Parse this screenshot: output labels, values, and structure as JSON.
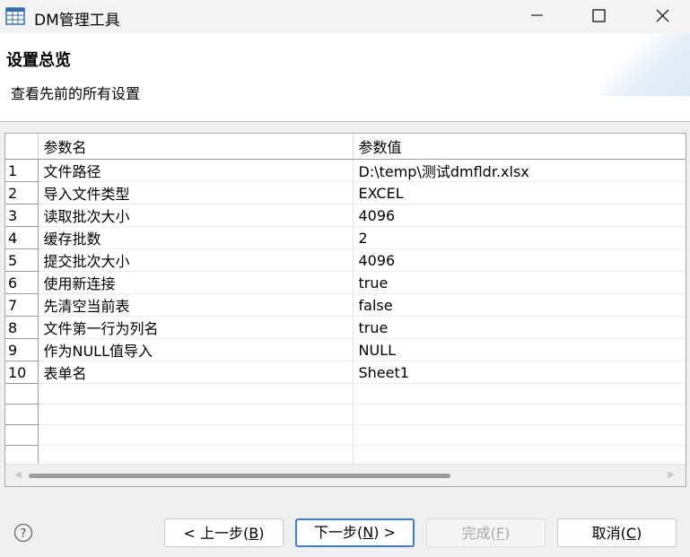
{
  "window": {
    "title": "DM管理工具",
    "icon": "table-app-icon",
    "controls": [
      "minimize-icon",
      "maximize-icon",
      "close-icon"
    ]
  },
  "header": {
    "title": "设置总览",
    "subtitle": "查看先前的所有设置"
  },
  "table": {
    "columns": [
      "参数名",
      "参数值"
    ],
    "rows": [
      {
        "num": "1",
        "name": "文件路径",
        "value": "D:\\temp\\测试dmfldr.xlsx"
      },
      {
        "num": "2",
        "name": "导入文件类型",
        "value": "EXCEL"
      },
      {
        "num": "3",
        "name": "读取批次大小",
        "value": "4096"
      },
      {
        "num": "4",
        "name": "缓存批数",
        "value": "2"
      },
      {
        "num": "5",
        "name": "提交批次大小",
        "value": "4096"
      },
      {
        "num": "6",
        "name": "使用新连接",
        "value": "true"
      },
      {
        "num": "7",
        "name": "先清空当前表",
        "value": "false"
      },
      {
        "num": "8",
        "name": "文件第一行为列名",
        "value": "true"
      },
      {
        "num": "9",
        "name": "作为NULL值导入",
        "value": "NULL"
      },
      {
        "num": "10",
        "name": "表单名",
        "value": "Sheet1"
      }
    ],
    "empty_rows": 5
  },
  "buttons": {
    "help_icon": "question-circle-icon",
    "prev": {
      "before": "< 上一步(",
      "key": "B",
      "after": ")"
    },
    "next": {
      "before": "下一步(",
      "key": "N",
      "after": ") >"
    },
    "finish": {
      "before": "完成(",
      "key": "F",
      "after": ")",
      "enabled": false
    },
    "cancel": {
      "before": "取消(",
      "key": "C",
      "after": ")"
    }
  },
  "colors": {
    "focus_border": "#3c7be0",
    "disabled_text": "#a8a8a8"
  }
}
